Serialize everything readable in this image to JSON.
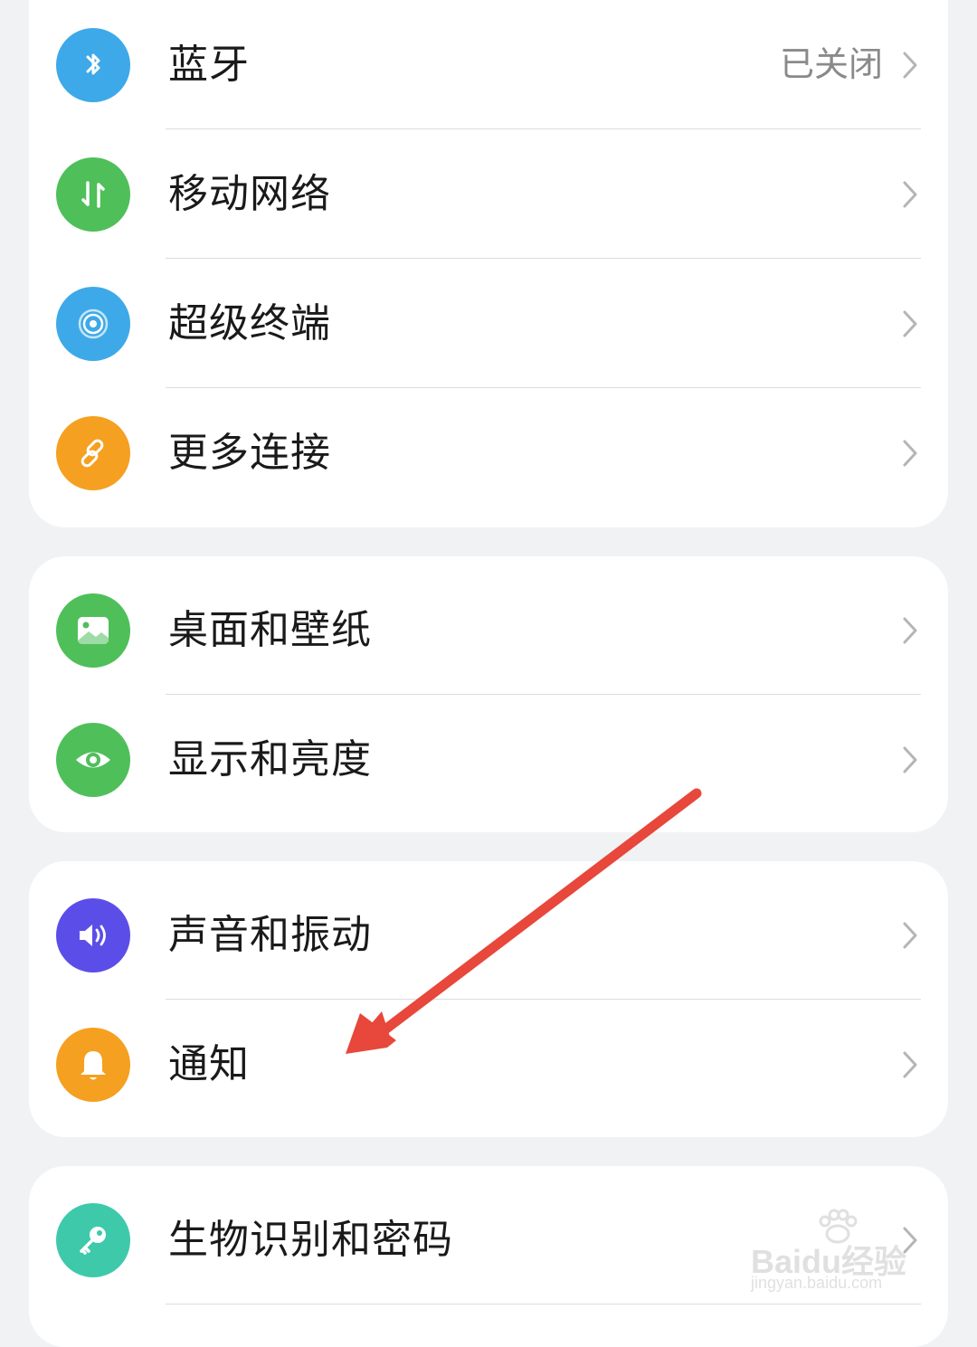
{
  "groups": [
    {
      "items": [
        {
          "label": "蓝牙",
          "value": "已关闭",
          "icon": "bluetooth-icon",
          "color": "#3ea9e8"
        },
        {
          "label": "移动网络",
          "value": "",
          "icon": "mobile-data-icon",
          "color": "#4fbf5a"
        },
        {
          "label": "超级终端",
          "value": "",
          "icon": "super-device-icon",
          "color": "#3ea9e8"
        },
        {
          "label": "更多连接",
          "value": "",
          "icon": "link-icon",
          "color": "#f5a020"
        }
      ]
    },
    {
      "items": [
        {
          "label": "桌面和壁纸",
          "value": "",
          "icon": "wallpaper-icon",
          "color": "#4fbf5a"
        },
        {
          "label": "显示和亮度",
          "value": "",
          "icon": "eye-icon",
          "color": "#4fbf5a"
        }
      ]
    },
    {
      "items": [
        {
          "label": "声音和振动",
          "value": "",
          "icon": "speaker-icon",
          "color": "#5b4ee8"
        },
        {
          "label": "通知",
          "value": "",
          "icon": "bell-icon",
          "color": "#f5a020"
        }
      ]
    },
    {
      "items": [
        {
          "label": "生物识别和密码",
          "value": "",
          "icon": "key-icon",
          "color": "#3fc9ab"
        }
      ]
    }
  ],
  "annotation": {
    "arrow_color": "#e8473b"
  },
  "watermark": {
    "brand": "Baidu经验",
    "url": "jingyan.baidu.com"
  }
}
